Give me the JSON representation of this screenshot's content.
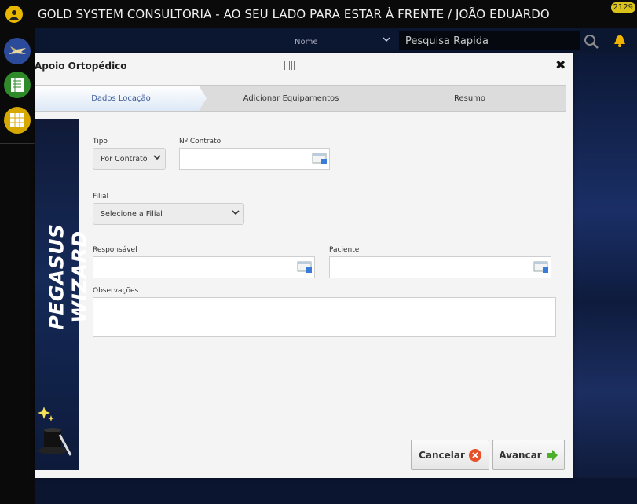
{
  "app": {
    "title": "GOLD SYSTEM CONSULTORIA - AO SEU LADO PARA ESTAR À FRENTE / JOÃO EDUARDO",
    "notification_count": "2129"
  },
  "search": {
    "field_selector": "Nome",
    "placeholder": "Pesquisa Rapida"
  },
  "modal": {
    "title": "Apoio Ortopédico",
    "steps": [
      {
        "label": "Dados Locação",
        "active": true
      },
      {
        "label": "Adicionar Equipamentos",
        "active": false
      },
      {
        "label": "Resumo",
        "active": false
      }
    ],
    "wizard_label": "PEGASUS WIZARD",
    "fields": {
      "tipo": {
        "label": "Tipo",
        "value": "Por Contrato"
      },
      "contrato": {
        "label": "Nº Contrato",
        "value": ""
      },
      "filial": {
        "label": "Filial",
        "value": "Selecione a Filial"
      },
      "responsavel": {
        "label": "Responsável",
        "value": ""
      },
      "paciente": {
        "label": "Paciente",
        "value": ""
      },
      "observacoes": {
        "label": "Observações",
        "value": ""
      }
    },
    "buttons": {
      "cancel": "Cancelar",
      "next": "Avancar"
    }
  },
  "colors": {
    "accent": "#3a5a99",
    "cancel_icon": "#e8502a",
    "next_icon": "#4caf2a",
    "gold": "#e8b800"
  }
}
